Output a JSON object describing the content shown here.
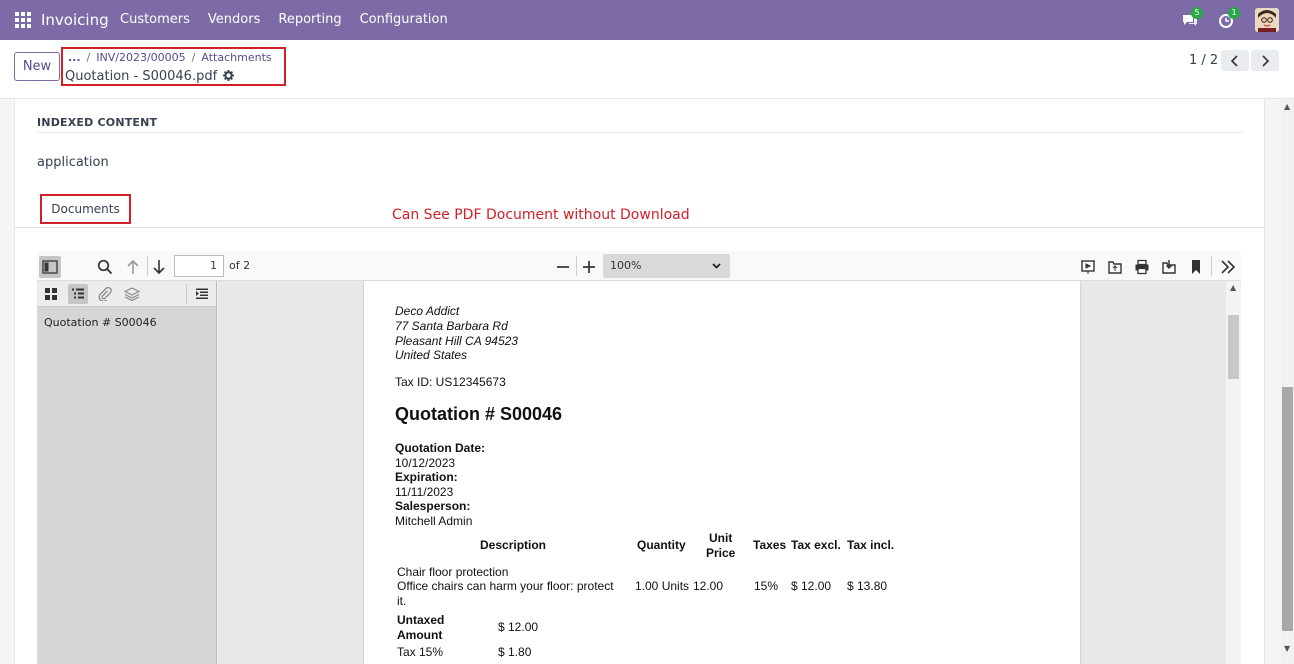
{
  "navbar": {
    "app_name": "Invoicing",
    "menu": [
      "Customers",
      "Vendors",
      "Reporting",
      "Configuration"
    ],
    "chat_badge": "5",
    "activity_badge": "1"
  },
  "control": {
    "new_label": "New",
    "breadcrumb_ellipsis": "...",
    "breadcrumb": [
      "INV/2023/00005",
      "Attachments"
    ],
    "current": "Quotation - S00046.pdf",
    "pager": "1 / 2"
  },
  "form": {
    "section_title": "INDEXED CONTENT",
    "indexed_value": "application",
    "tab_label": "Documents",
    "annotation": "Can See PDF Document without Download"
  },
  "pdf": {
    "page_number": "1",
    "page_of": "of 2",
    "zoom": "100%",
    "outline_item": "Quotation # S00046",
    "address": [
      "Deco Addict",
      "77 Santa Barbara Rd",
      "Pleasant Hill CA 94523",
      "United States"
    ],
    "tax_id": "Tax ID: US12345673",
    "heading": "Quotation # S00046",
    "quotation_date_label": "Quotation Date:",
    "quotation_date": "10/12/2023",
    "expiration_label": "Expiration:",
    "expiration": "11/11/2023",
    "salesperson_label": "Salesperson:",
    "salesperson": "Mitchell Admin",
    "table_headers": {
      "description": "Description",
      "quantity": "Quantity",
      "unit_price_1": "Unit",
      "unit_price_2": "Price",
      "taxes": "Taxes",
      "tax_excl": "Tax excl.",
      "tax_incl": "Tax incl."
    },
    "line": {
      "name": "Chair floor protection",
      "desc_1": "Office chairs can harm your floor: protect",
      "desc_2": "it.",
      "quantity": "1.00 Units",
      "unit_price": "12.00",
      "taxes": "15%",
      "tax_excl": "$ 12.00",
      "tax_incl": "$ 13.80"
    },
    "untaxed_label_1": "Untaxed",
    "untaxed_label_2": "Amount",
    "untaxed_value": "$ 12.00",
    "tax_label": "Tax 15%",
    "tax_value": "$ 1.80"
  }
}
